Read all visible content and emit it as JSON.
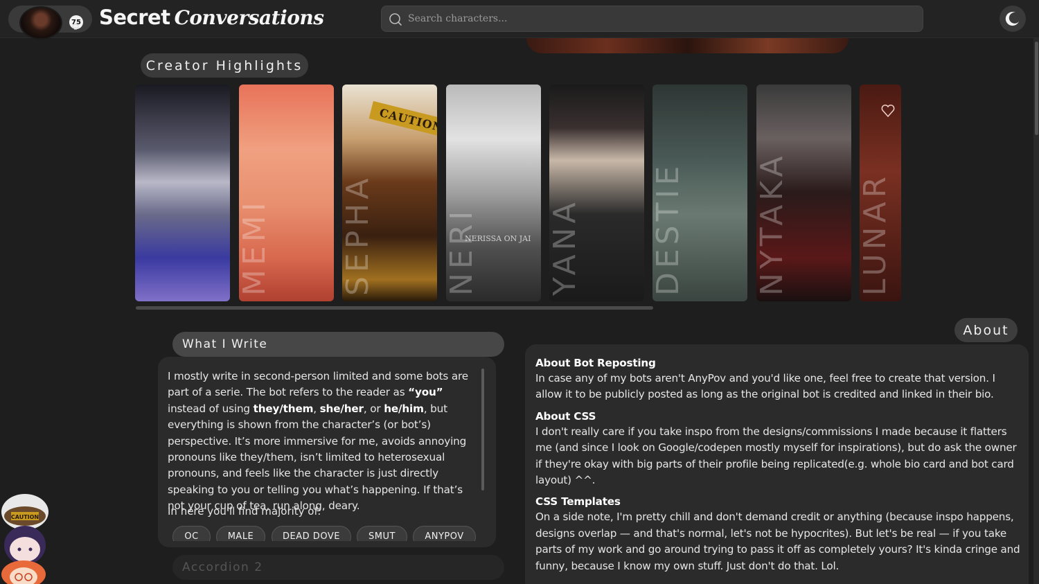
{
  "header": {
    "notification_count": "75",
    "brand_primary": "Secret",
    "brand_secondary": "Conversations",
    "search_placeholder": "Search characters..."
  },
  "highlights": {
    "title": "Creator Highlights",
    "cards": [
      {
        "name": ""
      },
      {
        "name": "MEMI"
      },
      {
        "name": "SEPHA",
        "overlay": "CAUTION"
      },
      {
        "name": "NERI",
        "overlay": "NERISSA ON JAI"
      },
      {
        "name": "YANA"
      },
      {
        "name": "DESTIE"
      },
      {
        "name": "NYTAKA"
      },
      {
        "name": "LUNAR"
      }
    ]
  },
  "what_i_write": {
    "title": "What I Write",
    "find_label": "In here you'll find majority of:",
    "tags": [
      "OC",
      "MALE",
      "DEAD DOVE",
      "SMUT",
      "ANYPOV"
    ],
    "accordion2_title": "Accordion 2"
  },
  "about": {
    "title": "About",
    "sections": [
      {
        "heading": "About Bot Reposting",
        "body": "In case any of my bots aren't AnyPov and you'd like one, feel free to create that version. I allow it to be publicly posted as long as the original bot is credited and linked in their bio."
      },
      {
        "heading": "About CSS",
        "body": "I don't really care if you take inspo from the designs/commissions I made because it flatters me (and since I look on Google/codepen mostly myself for inspirations), but do ask the owner if they're okay with big parts of their profile being replicated(e.g. whole bio card and bot card layout) ^^."
      },
      {
        "heading": "CSS Templates",
        "body": "On a side note, I'm pretty chill and don't demand credit or anything (because inspo happens, designs overlap — and that's normal, let's not be hypocrites). But let's be real — if you take parts of my work and go around trying to pass it off as completely yours? It's kinda cringe and funny, because I know my own stuff. Just don't do that. Lol."
      }
    ]
  },
  "mascot": {
    "hat_text": "CAUTION"
  },
  "colors": {
    "background": "#1e1e1f",
    "panel": "#2b2b2c",
    "pill": "#3a3a3b"
  }
}
